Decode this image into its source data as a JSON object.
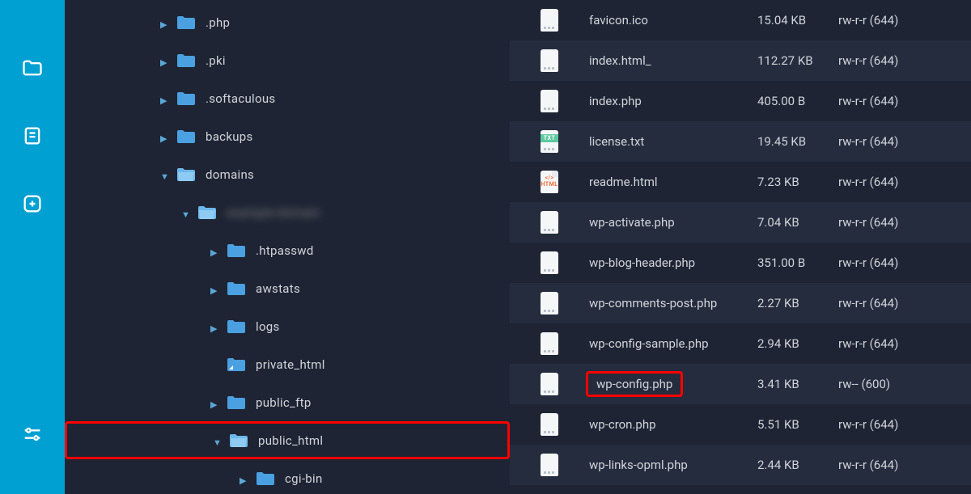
{
  "colors": {
    "accent": "#00a0d2",
    "highlight": "#ff0000"
  },
  "sidebarNav": [
    {
      "name": "files-icon"
    },
    {
      "name": "notes-icon"
    },
    {
      "name": "add-icon"
    },
    {
      "name": "settings-icon"
    }
  ],
  "tree": [
    {
      "indent": 0,
      "expanded": false,
      "open": false,
      "label": ".php",
      "highlighted": false
    },
    {
      "indent": 0,
      "expanded": false,
      "open": false,
      "label": ".pki",
      "highlighted": false
    },
    {
      "indent": 0,
      "expanded": false,
      "open": false,
      "label": ".softaculous",
      "highlighted": false
    },
    {
      "indent": 0,
      "expanded": false,
      "open": false,
      "label": "backups",
      "highlighted": false
    },
    {
      "indent": 0,
      "expanded": true,
      "open": true,
      "label": "domains",
      "highlighted": false
    },
    {
      "indent": 1,
      "expanded": true,
      "open": true,
      "label": "example-domain",
      "highlighted": false,
      "blurred": true
    },
    {
      "indent": 2,
      "expanded": false,
      "open": false,
      "label": ".htpasswd",
      "highlighted": false
    },
    {
      "indent": 2,
      "expanded": false,
      "open": false,
      "label": "awstats",
      "highlighted": false
    },
    {
      "indent": 2,
      "expanded": false,
      "open": false,
      "label": "logs",
      "highlighted": false
    },
    {
      "indent": 2,
      "expanded": null,
      "open": false,
      "label": "private_html",
      "highlighted": false,
      "linkArrow": true
    },
    {
      "indent": 2,
      "expanded": false,
      "open": false,
      "label": "public_ftp",
      "highlighted": false
    },
    {
      "indent": 2,
      "expanded": true,
      "open": true,
      "label": "public_html",
      "highlighted": true
    },
    {
      "indent": 3,
      "expanded": false,
      "open": false,
      "label": "cgi-bin",
      "highlighted": false
    }
  ],
  "files": [
    {
      "icon": "file",
      "name": "favicon.ico",
      "size": "15.04 KB",
      "perm": "rw-r-r (644)",
      "highlighted": false
    },
    {
      "icon": "file",
      "name": "index.html_",
      "size": "112.27 KB",
      "perm": "rw-r-r (644)",
      "highlighted": false
    },
    {
      "icon": "file",
      "name": "index.php",
      "size": "405.00 B",
      "perm": "rw-r-r (644)",
      "highlighted": false
    },
    {
      "icon": "txt",
      "name": "license.txt",
      "size": "19.45 KB",
      "perm": "rw-r-r (644)",
      "highlighted": false
    },
    {
      "icon": "html",
      "name": "readme.html",
      "size": "7.23 KB",
      "perm": "rw-r-r (644)",
      "highlighted": false
    },
    {
      "icon": "file",
      "name": "wp-activate.php",
      "size": "7.04 KB",
      "perm": "rw-r-r (644)",
      "highlighted": false
    },
    {
      "icon": "file",
      "name": "wp-blog-header.php",
      "size": "351.00 B",
      "perm": "rw-r-r (644)",
      "highlighted": false
    },
    {
      "icon": "file",
      "name": "wp-comments-post.php",
      "size": "2.27 KB",
      "perm": "rw-r-r (644)",
      "highlighted": false
    },
    {
      "icon": "file",
      "name": "wp-config-sample.php",
      "size": "2.94 KB",
      "perm": "rw-r-r (644)",
      "highlighted": false
    },
    {
      "icon": "file",
      "name": "wp-config.php",
      "size": "3.41 KB",
      "perm": "rw-- (600)",
      "highlighted": true
    },
    {
      "icon": "file",
      "name": "wp-cron.php",
      "size": "5.51 KB",
      "perm": "rw-r-r (644)",
      "highlighted": false
    },
    {
      "icon": "file",
      "name": "wp-links-opml.php",
      "size": "2.44 KB",
      "perm": "rw-r-r (644)",
      "highlighted": false
    }
  ]
}
